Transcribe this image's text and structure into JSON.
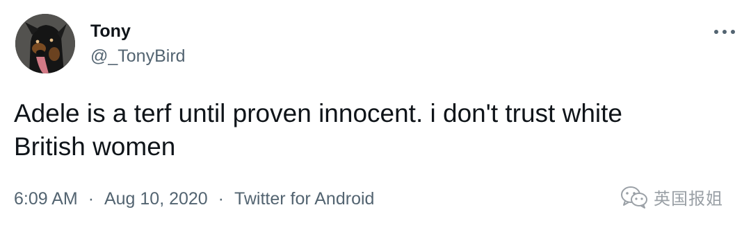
{
  "author": {
    "name": "Tony",
    "handle": "@_TonyBird"
  },
  "tweet": {
    "line1": "Adele is a terf until proven innocent. i don't trust white",
    "line2": "British women"
  },
  "meta": {
    "time": "6:09 AM",
    "separator": "·",
    "date": "Aug 10, 2020",
    "source": "Twitter for Android"
  },
  "watermark": {
    "text": "英国报姐",
    "icon": "wechat-icon"
  },
  "icons": {
    "more": "more-horizontal-icon",
    "avatar": "avatar"
  },
  "colors": {
    "text": "#0f1419",
    "secondary": "#536471",
    "watermark": "#9aa0a6"
  }
}
